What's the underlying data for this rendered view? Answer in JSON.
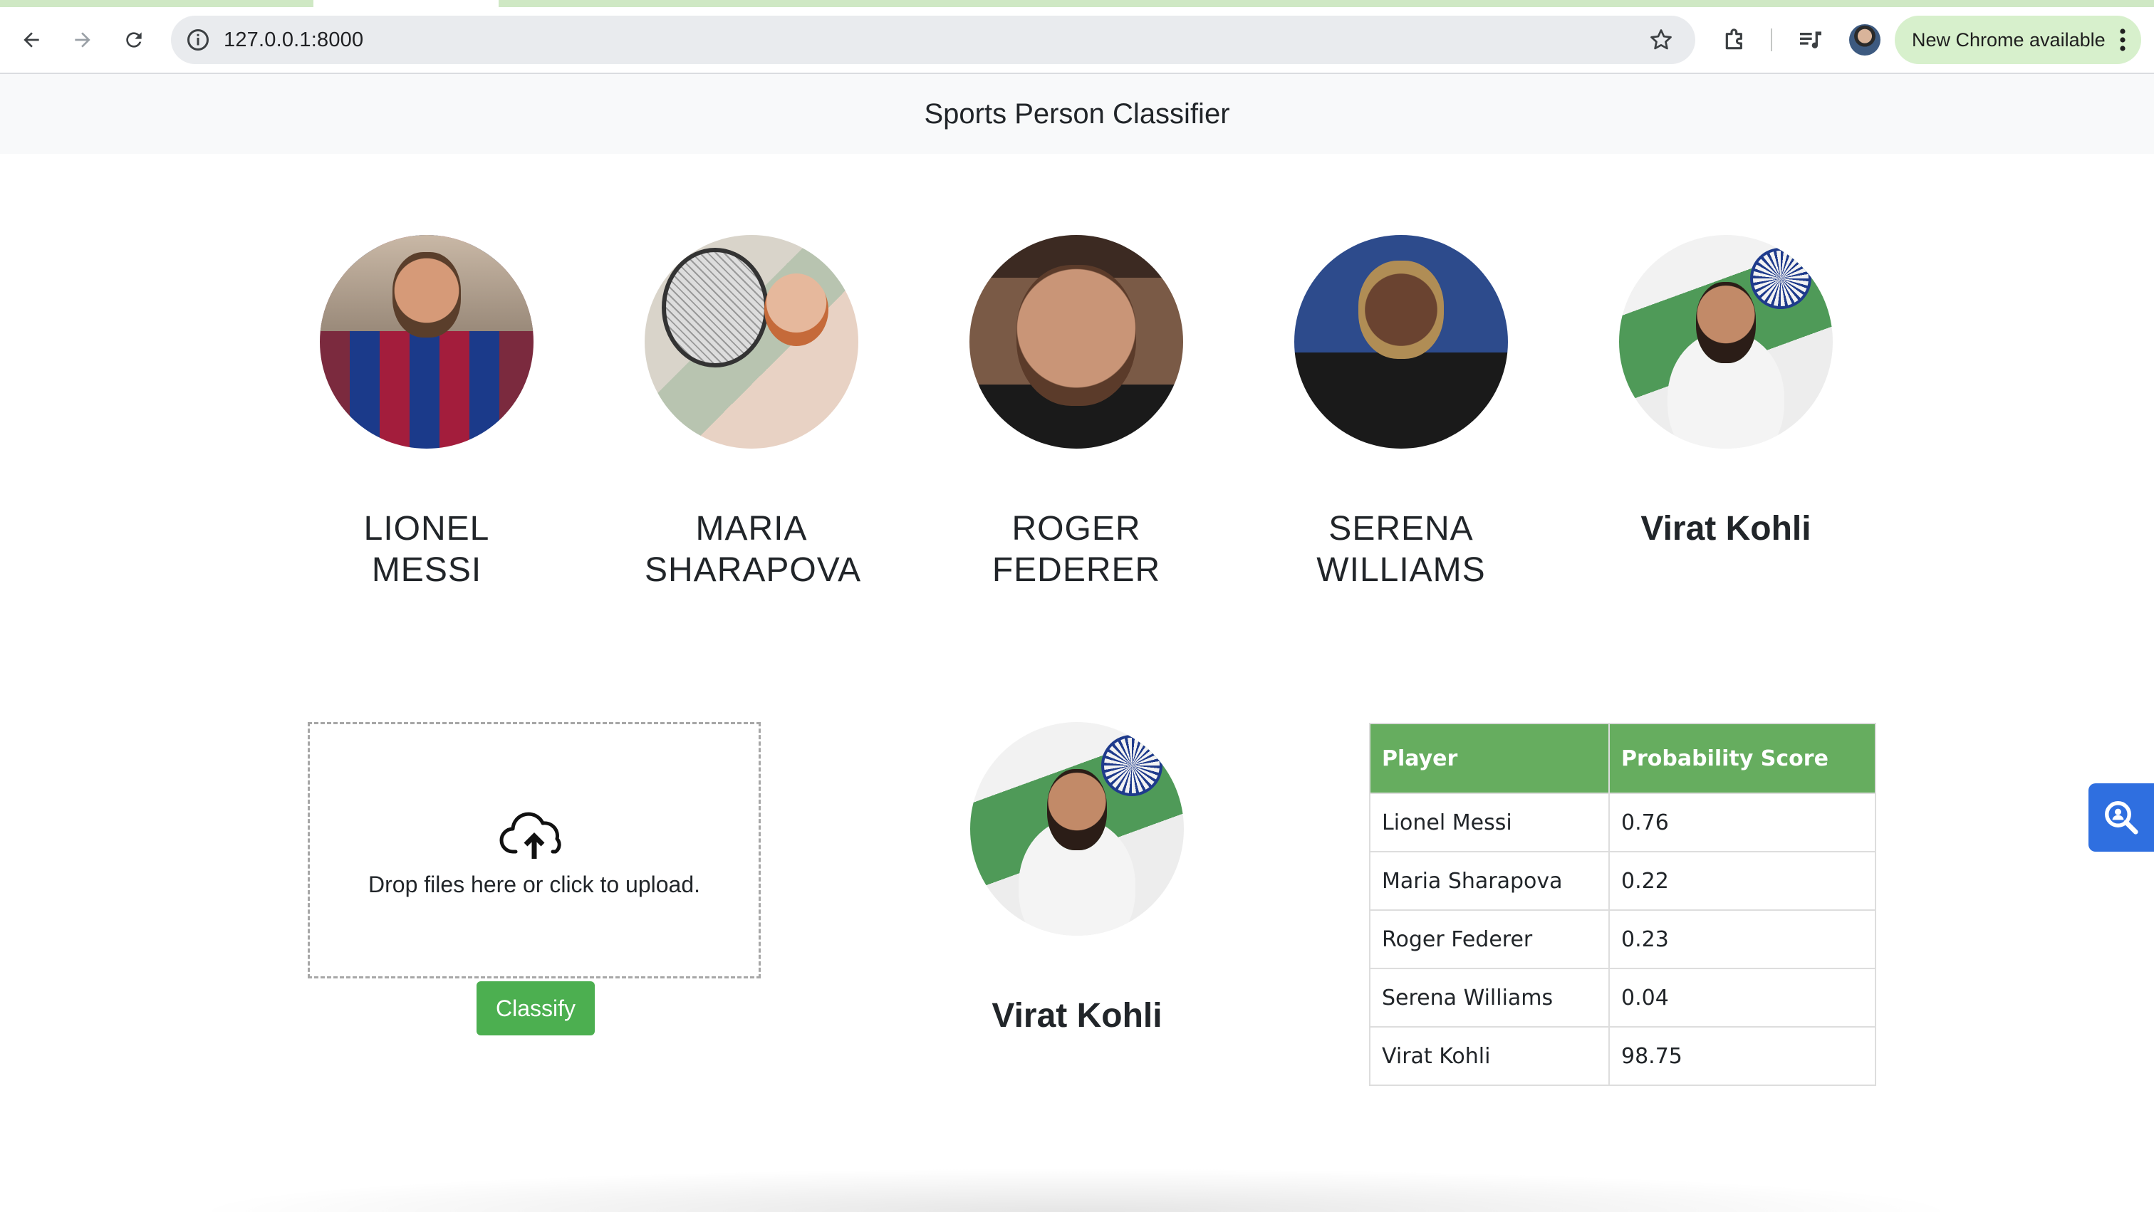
{
  "browser": {
    "url": "127.0.0.1:8000",
    "update_label": "New Chrome available"
  },
  "header": {
    "title": "Sports Person Classifier"
  },
  "players": [
    {
      "name_line1": "LIONEL",
      "name_line2": "MESSI",
      "portrait": "lionel-messi-photo"
    },
    {
      "name_line1": "MARIA",
      "name_line2": "SHARAPOVA",
      "portrait": "maria-sharapova-photo"
    },
    {
      "name_line1": "ROGER",
      "name_line2": "FEDERER",
      "portrait": "roger-federer-photo"
    },
    {
      "name_line1": "SERENA",
      "name_line2": "WILLIAMS",
      "portrait": "serena-williams-photo"
    },
    {
      "name_line1": "Virat Kohli",
      "name_line2": "",
      "portrait": "virat-kohli-photo"
    }
  ],
  "upload": {
    "prompt": "Drop files here or click to upload.",
    "icon": "cloud-upload-icon",
    "button_label": "Classify"
  },
  "result": {
    "name": "Virat Kohli",
    "portrait": "virat-kohli-photo"
  },
  "scores_table": {
    "headers": [
      "Player",
      "Probability Score"
    ],
    "rows": [
      [
        "Lionel Messi",
        "0.76"
      ],
      [
        "Maria Sharapova",
        "0.22"
      ],
      [
        "Roger Federer",
        "0.23"
      ],
      [
        "Serena Williams",
        "0.04"
      ],
      [
        "Virat Kohli",
        "98.75"
      ]
    ]
  },
  "colors": {
    "accent_green": "#4caf50",
    "table_header": "#66ad5f",
    "header_bg": "#f8f9fa",
    "float_tool": "#2f6fe0"
  }
}
